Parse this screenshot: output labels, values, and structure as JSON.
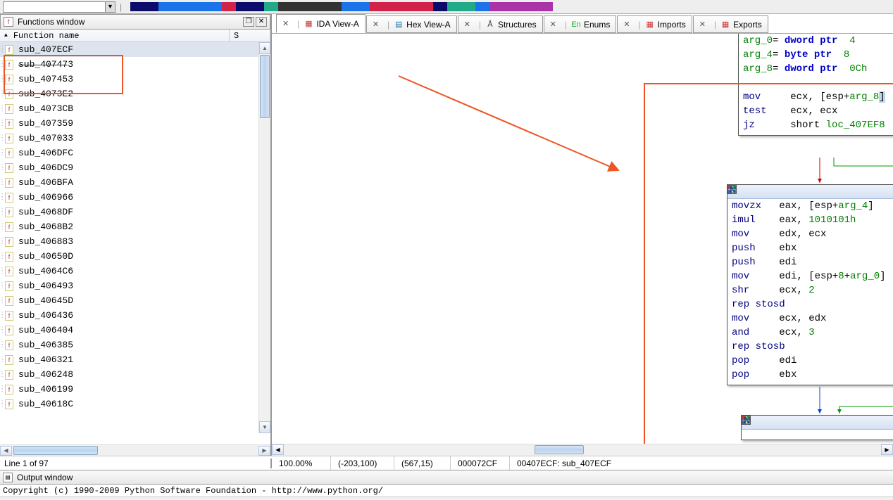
{
  "functions_panel": {
    "title": "Functions window",
    "header": {
      "name_col": "Function name",
      "segment_initial": "S"
    },
    "items": [
      "sub_407ECF",
      "sub_407473",
      "sub_407453",
      "sub_4073E2",
      "sub_4073CB",
      "sub_407359",
      "sub_407033",
      "sub_406DFC",
      "sub_406DC9",
      "sub_406BFA",
      "sub_406966",
      "sub_4068DF",
      "sub_4068B2",
      "sub_406883",
      "sub_40650D",
      "sub_4064C6",
      "sub_406493",
      "sub_40645D",
      "sub_406436",
      "sub_406404",
      "sub_406385",
      "sub_406321",
      "sub_406248",
      "sub_406199",
      "sub_40618C"
    ],
    "status": "Line 1 of 97"
  },
  "tabs": [
    {
      "label": "IDA View-A",
      "icon_color": "#c33",
      "icon": "▦"
    },
    {
      "label": "Hex View-A",
      "icon_color": "#27a",
      "icon": "▤"
    },
    {
      "label": "Structures",
      "icon_color": "#333",
      "icon": "Å"
    },
    {
      "label": "Enums",
      "icon_color": "#2a3",
      "icon": "En"
    },
    {
      "label": "Imports",
      "icon_color": "#c33",
      "icon": "▦"
    },
    {
      "label": "Exports",
      "icon_color": "#c33",
      "icon": "▦"
    }
  ],
  "graph": {
    "node1": {
      "lines": [
        [
          {
            "t": "arg_0",
            "c": "kw-green"
          },
          {
            "t": "= "
          },
          {
            "t": "dword ptr  ",
            "c": "kw-blue"
          },
          {
            "t": "4",
            "c": "kw-green"
          }
        ],
        [
          {
            "t": "arg_4",
            "c": "kw-green"
          },
          {
            "t": "= "
          },
          {
            "t": "byte ptr  ",
            "c": "kw-blue"
          },
          {
            "t": "8",
            "c": "kw-green"
          }
        ],
        [
          {
            "t": "arg_8",
            "c": "kw-green"
          },
          {
            "t": "= "
          },
          {
            "t": "dword ptr  ",
            "c": "kw-blue"
          },
          {
            "t": "0Ch",
            "c": "kw-green"
          }
        ],
        [],
        [
          {
            "t": "mov     ",
            "c": "kw-navy"
          },
          {
            "t": "ecx"
          },
          {
            "t": ", ["
          },
          {
            "t": "esp"
          },
          {
            "t": "+"
          },
          {
            "t": "arg_8",
            "c": "kw-green"
          },
          {
            "t": "]",
            "cursor": true
          }
        ],
        [
          {
            "t": "test    ",
            "c": "kw-navy"
          },
          {
            "t": "ecx"
          },
          {
            "t": ", "
          },
          {
            "t": "ecx"
          }
        ],
        [
          {
            "t": "jz      ",
            "c": "kw-navy"
          },
          {
            "t": "short "
          },
          {
            "t": "loc_407EF8",
            "c": "kw-green"
          }
        ]
      ]
    },
    "node2": {
      "lines": [
        [
          {
            "t": "movzx   ",
            "c": "kw-navy"
          },
          {
            "t": "eax"
          },
          {
            "t": ", ["
          },
          {
            "t": "esp"
          },
          {
            "t": "+"
          },
          {
            "t": "arg_4",
            "c": "kw-green"
          },
          {
            "t": "]"
          }
        ],
        [
          {
            "t": "imul    ",
            "c": "kw-navy"
          },
          {
            "t": "eax"
          },
          {
            "t": ", "
          },
          {
            "t": "1010101h",
            "c": "kw-green"
          }
        ],
        [
          {
            "t": "mov     ",
            "c": "kw-navy"
          },
          {
            "t": "edx"
          },
          {
            "t": ", "
          },
          {
            "t": "ecx"
          }
        ],
        [
          {
            "t": "push    ",
            "c": "kw-navy"
          },
          {
            "t": "ebx"
          }
        ],
        [
          {
            "t": "push    ",
            "c": "kw-navy"
          },
          {
            "t": "edi"
          }
        ],
        [
          {
            "t": "mov     ",
            "c": "kw-navy"
          },
          {
            "t": "edi"
          },
          {
            "t": ", ["
          },
          {
            "t": "esp"
          },
          {
            "t": "+"
          },
          {
            "t": "8",
            "c": "kw-green"
          },
          {
            "t": "+"
          },
          {
            "t": "arg_0",
            "c": "kw-green"
          },
          {
            "t": "]"
          }
        ],
        [
          {
            "t": "shr     ",
            "c": "kw-navy"
          },
          {
            "t": "ecx"
          },
          {
            "t": ", "
          },
          {
            "t": "2",
            "c": "kw-green"
          }
        ],
        [
          {
            "t": "rep stosd",
            "c": "kw-navy"
          }
        ],
        [
          {
            "t": "mov     ",
            "c": "kw-navy"
          },
          {
            "t": "ecx"
          },
          {
            "t": ", "
          },
          {
            "t": "edx"
          }
        ],
        [
          {
            "t": "and     ",
            "c": "kw-navy"
          },
          {
            "t": "ecx"
          },
          {
            "t": ", "
          },
          {
            "t": "3",
            "c": "kw-green"
          }
        ],
        [
          {
            "t": "rep stosb",
            "c": "kw-navy"
          }
        ],
        [
          {
            "t": "pop     ",
            "c": "kw-navy"
          },
          {
            "t": "edi"
          }
        ],
        [
          {
            "t": "pop     ",
            "c": "kw-navy"
          },
          {
            "t": "ebx"
          }
        ]
      ]
    }
  },
  "status_bar": {
    "zoom": "100.00%",
    "coord1": "(-203,100)",
    "coord2": "(567,15)",
    "offset": "000072CF",
    "addr": "00407ECF: sub_407ECF"
  },
  "output": {
    "title": "Output window",
    "line": "Copyright (c) 1990-2009 Python Software Foundation - http://www.python.org/"
  },
  "navmap_colors": [
    "#0b0b6b",
    "#1a73e8",
    "#d1234a",
    "#0b0b6b",
    "#2a8",
    "#333",
    "#1a73e8",
    "#d1234a",
    "#0b0b6b",
    "#2a8",
    "#1a73e8",
    "#a3a"
  ]
}
